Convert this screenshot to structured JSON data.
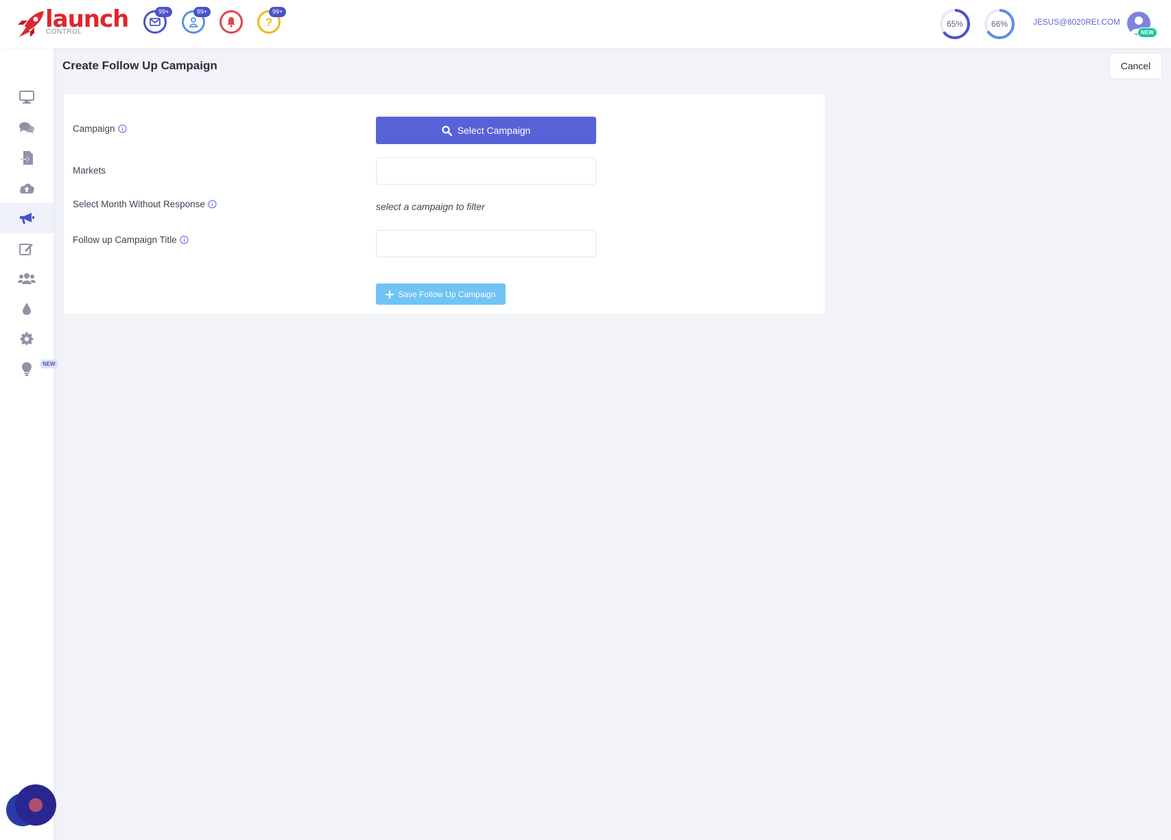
{
  "header": {
    "logo": {
      "word": "launch",
      "sub": "CONTROL"
    },
    "icons": [
      {
        "name": "mail-icon",
        "badge": "99+",
        "color": "#4a52c8"
      },
      {
        "name": "user-icon",
        "badge": "99+",
        "color": "#5b8fe0"
      },
      {
        "name": "bell-icon",
        "badge": "",
        "color": "#e0454a"
      },
      {
        "name": "help-icon",
        "badge": "99+",
        "color": "#f2b81c"
      }
    ],
    "progress": [
      {
        "label": "65%",
        "value": 65,
        "color": "#4a52c8"
      },
      {
        "label": "66%",
        "value": 66,
        "color": "#5b8fe0"
      }
    ],
    "user_email": "JESUS@8020REI.COM",
    "avatar_badge": "NEW"
  },
  "sidebar": {
    "items": [
      {
        "icon": "monitor-icon"
      },
      {
        "icon": "chat-icon"
      },
      {
        "icon": "file-import-icon"
      },
      {
        "icon": "cloud-upload-icon"
      },
      {
        "icon": "megaphone-icon",
        "active": true
      },
      {
        "icon": "edit-icon"
      },
      {
        "icon": "users-icon"
      },
      {
        "icon": "drop-icon"
      },
      {
        "icon": "gear-icon"
      },
      {
        "icon": "lightbulb-icon",
        "badge": "NEW"
      }
    ]
  },
  "page": {
    "title": "Create Follow Up Campaign",
    "cancel_label": "Cancel"
  },
  "form": {
    "campaign_label": "Campaign",
    "select_campaign_label": "Select Campaign",
    "markets_label": "Markets",
    "markets_value": "",
    "month_label": "Select Month Without Response",
    "month_hint": "select a campaign to filter",
    "title_label": "Follow up Campaign Title",
    "title_value": "",
    "save_label": "Save Follow Up Campaign"
  },
  "colors": {
    "primary": "#5762d8",
    "save_disabled": "#6fc3f6",
    "brand_red": "#e0262c"
  }
}
